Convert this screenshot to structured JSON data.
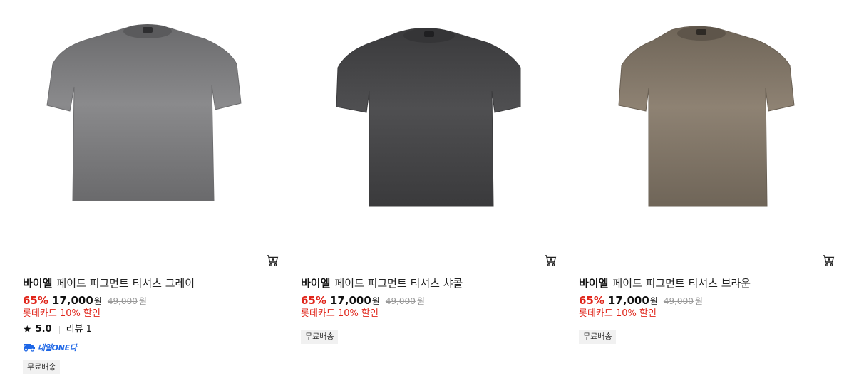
{
  "products": [
    {
      "brand": "바이엘",
      "name": "페이드 피그먼트 티셔츠 그레이",
      "discount": "65%",
      "price": "17,000",
      "price_unit": "원",
      "original_price": "49,000",
      "original_unit": "원",
      "card_promo": "롯데카드 10% 할인",
      "rating": "5.0",
      "review_label": "리뷰 1",
      "delivery_badge": "내일ONE다",
      "tag": "무료배송",
      "shirt_color": "#8a8a8c",
      "shirt_shade": "#6a6a6c",
      "cart_icon": "cart-icon",
      "star_icon": "star-icon"
    },
    {
      "brand": "바이엘",
      "name": "페이드 피그먼트 티셔츠 챠콜",
      "discount": "65%",
      "price": "17,000",
      "price_unit": "원",
      "original_price": "49,000",
      "original_unit": "원",
      "card_promo": "롯데카드 10% 할인",
      "tag": "무료배송",
      "shirt_color": "#4f4f51",
      "shirt_shade": "#3a3a3c",
      "cart_icon": "cart-icon"
    },
    {
      "brand": "바이엘",
      "name": "페이드 피그먼트 티셔츠 브라운",
      "discount": "65%",
      "price": "17,000",
      "price_unit": "원",
      "original_price": "49,000",
      "original_unit": "원",
      "card_promo": "롯데카드 10% 할인",
      "tag": "무료배송",
      "shirt_color": "#8e8273",
      "shirt_shade": "#6f6558",
      "cart_icon": "cart-icon"
    }
  ],
  "colors": {
    "discount": "#e0261b",
    "delivery_blue": "#1d66e6",
    "tag_bg": "#f1f1f1"
  }
}
